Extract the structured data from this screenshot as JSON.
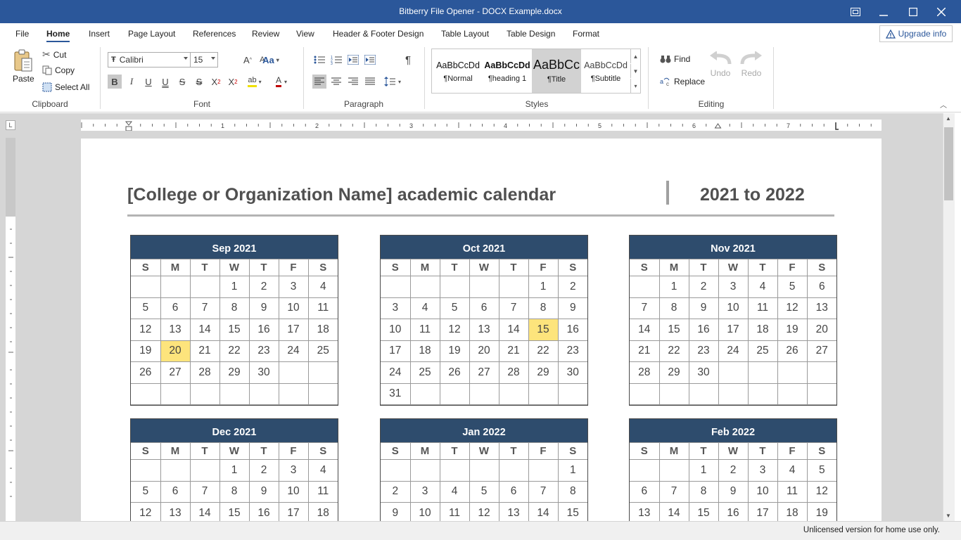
{
  "window": {
    "title": "Bitberry File Opener - DOCX Example.docx"
  },
  "menu": {
    "tabs": [
      "File",
      "Home",
      "Insert",
      "Page Layout",
      "References",
      "Review",
      "View",
      "Header & Footer Design",
      "Table Layout",
      "Table Design",
      "Format"
    ],
    "active": "Home",
    "upgrade": "Upgrade info"
  },
  "ribbon": {
    "clipboard": {
      "label": "Clipboard",
      "paste": "Paste",
      "cut": "Cut",
      "copy": "Copy",
      "select_all": "Select All"
    },
    "font": {
      "label": "Font",
      "family": "Calibri",
      "size": "15"
    },
    "paragraph": {
      "label": "Paragraph"
    },
    "styles": {
      "label": "Styles",
      "items": [
        {
          "preview": "AaBbCcDd",
          "name": "¶Normal"
        },
        {
          "preview": "AaBbCcDd",
          "name": "¶heading 1"
        },
        {
          "preview": "AaBbCc",
          "name": "¶Title"
        },
        {
          "preview": "AaBbCcDd",
          "name": "¶Subtitle"
        }
      ]
    },
    "editing": {
      "label": "Editing",
      "find": "Find",
      "replace": "Replace",
      "undo": "Undo",
      "redo": "Redo"
    }
  },
  "ruler": {
    "numbers": [
      "1",
      "2",
      "3",
      "4",
      "5",
      "6",
      "7"
    ]
  },
  "document": {
    "title": "[College or Organization Name] academic calendar",
    "year": "2021 to 2022",
    "weekdays": [
      "S",
      "M",
      "T",
      "W",
      "T",
      "F",
      "S"
    ],
    "months": [
      {
        "name": "Sep 2021",
        "weeks": [
          [
            "",
            "",
            "",
            "1",
            "2",
            "3",
            "4"
          ],
          [
            "5",
            "6",
            "7",
            "8",
            "9",
            "10",
            "11"
          ],
          [
            "12",
            "13",
            "14",
            "15",
            "16",
            "17",
            "18"
          ],
          [
            "19",
            "20",
            "21",
            "22",
            "23",
            "24",
            "25"
          ],
          [
            "26",
            "27",
            "28",
            "29",
            "30",
            "",
            ""
          ],
          [
            "",
            "",
            "",
            "",
            "",
            "",
            ""
          ]
        ],
        "highlight": [
          "20"
        ]
      },
      {
        "name": "Oct 2021",
        "weeks": [
          [
            "",
            "",
            "",
            "",
            "",
            "1",
            "2"
          ],
          [
            "3",
            "4",
            "5",
            "6",
            "7",
            "8",
            "9"
          ],
          [
            "10",
            "11",
            "12",
            "13",
            "14",
            "15",
            "16"
          ],
          [
            "17",
            "18",
            "19",
            "20",
            "21",
            "22",
            "23"
          ],
          [
            "24",
            "25",
            "26",
            "27",
            "28",
            "29",
            "30"
          ],
          [
            "31",
            "",
            "",
            "",
            "",
            "",
            ""
          ]
        ],
        "highlight": [
          "15"
        ]
      },
      {
        "name": "Nov 2021",
        "weeks": [
          [
            "",
            "1",
            "2",
            "3",
            "4",
            "5",
            "6"
          ],
          [
            "7",
            "8",
            "9",
            "10",
            "11",
            "12",
            "13"
          ],
          [
            "14",
            "15",
            "16",
            "17",
            "18",
            "19",
            "20"
          ],
          [
            "21",
            "22",
            "23",
            "24",
            "25",
            "26",
            "27"
          ],
          [
            "28",
            "29",
            "30",
            "",
            "",
            "",
            ""
          ],
          [
            "",
            "",
            "",
            "",
            "",
            "",
            ""
          ]
        ],
        "highlight": []
      },
      {
        "name": "Dec 2021",
        "weeks": [
          [
            "",
            "",
            "",
            "1",
            "2",
            "3",
            "4"
          ],
          [
            "5",
            "6",
            "7",
            "8",
            "9",
            "10",
            "11"
          ],
          [
            "12",
            "13",
            "14",
            "15",
            "16",
            "17",
            "18"
          ]
        ],
        "highlight": []
      },
      {
        "name": "Jan 2022",
        "weeks": [
          [
            "",
            "",
            "",
            "",
            "",
            "",
            "1"
          ],
          [
            "2",
            "3",
            "4",
            "5",
            "6",
            "7",
            "8"
          ],
          [
            "9",
            "10",
            "11",
            "12",
            "13",
            "14",
            "15"
          ]
        ],
        "highlight": []
      },
      {
        "name": "Feb 2022",
        "weeks": [
          [
            "",
            "",
            "1",
            "2",
            "3",
            "4",
            "5"
          ],
          [
            "6",
            "7",
            "8",
            "9",
            "10",
            "11",
            "12"
          ],
          [
            "13",
            "14",
            "15",
            "16",
            "17",
            "18",
            "19"
          ]
        ],
        "highlight": []
      }
    ]
  },
  "status": {
    "text": "Unlicensed version for home use only."
  },
  "colors": {
    "titlebar": "#2b579a",
    "month_header": "#2e4c6d",
    "highlight": "#fde47c"
  }
}
